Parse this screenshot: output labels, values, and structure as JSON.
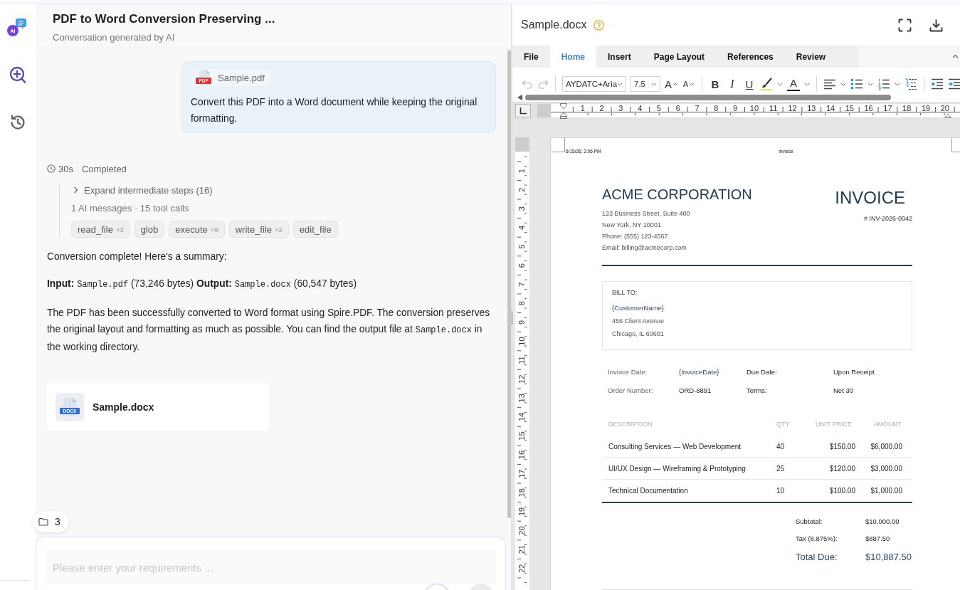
{
  "rail": {
    "logo_text": "AI"
  },
  "conversation": {
    "title": "PDF to Word Conversion Preserving ...",
    "subtitle": "Conversation generated by AI",
    "user_message": {
      "attachment": {
        "name": "Sample.pdf",
        "type_label": "PDF"
      },
      "text": "Convert this PDF into a Word document while keeping the original formatting."
    },
    "run": {
      "duration": "30s",
      "status": "Completed",
      "steps": {
        "label": "Expand intermediate steps (16)",
        "expanded": false,
        "summary": "1 AI messages · 15 tool calls",
        "tools": [
          {
            "name": "read_file",
            "count": "×3"
          },
          {
            "name": "glob"
          },
          {
            "name": "execute",
            "count": "×8"
          },
          {
            "name": "write_file",
            "count": "×2"
          },
          {
            "name": "edit_file"
          }
        ]
      }
    },
    "reply": [
      {
        "segments": [
          {
            "kind": "plain",
            "text": "Conversion complete! Here's a summary:"
          }
        ]
      },
      {
        "segments": [
          {
            "kind": "bold",
            "text": "Input:"
          },
          {
            "kind": "code",
            "text": "Sample.pdf"
          },
          {
            "kind": "plain",
            "text": "(73,246 bytes)"
          },
          {
            "kind": "bold",
            "text": "Output:"
          },
          {
            "kind": "code",
            "text": "Sample.docx"
          },
          {
            "kind": "plain",
            "text": "(60,547 bytes)"
          }
        ]
      },
      {
        "segments": [
          {
            "kind": "plain",
            "text": "The PDF has been successfully converted to Word format using Spire.PDF. The conversion preserves the original layout and formatting as much as possible. You can find the output file at"
          },
          {
            "kind": "code",
            "text": "Sample.docx"
          },
          {
            "kind": "plain",
            "text": "in the working directory."
          }
        ]
      }
    ],
    "result_file": {
      "name": "Sample.docx",
      "type_label": "DOCX"
    },
    "folder_badge": {
      "count": "3"
    },
    "composer": {
      "placeholder": "Please enter your requirements ..."
    }
  },
  "document": {
    "file_name": "Sample.docx",
    "ribbon_tabs": [
      {
        "label": "File",
        "selected": false
      },
      {
        "label": "Home",
        "selected": true
      },
      {
        "label": "Insert",
        "selected": false
      },
      {
        "label": "Page Layout",
        "selected": false
      },
      {
        "label": "References",
        "selected": false
      },
      {
        "label": "Review",
        "selected": false
      }
    ],
    "toolbar": {
      "undo": {
        "disabled": true
      },
      "redo": {
        "disabled": true
      },
      "font_name": "AYDATC+Aria",
      "font_size": "7.5",
      "grow_font": "A",
      "shrink_font": "A",
      "bold": "B",
      "italic": "I",
      "underline": "U",
      "font_color": "A"
    },
    "horizontal_ruler": [
      "1",
      "2",
      "3",
      "4",
      "5",
      "6",
      "7",
      "8",
      "9",
      "10",
      "11",
      "12",
      "13",
      "14",
      "15",
      "16",
      "17",
      "18",
      "19",
      "20"
    ],
    "vertical_ruler": [
      "1",
      "2",
      "3",
      "4",
      "5",
      "6",
      "7",
      "8",
      "9",
      "10",
      "11",
      "12",
      "13",
      "14",
      "15",
      "16",
      "17",
      "18",
      "19",
      "20",
      "21",
      "22"
    ],
    "page": {
      "header_left": "6/15/26, 2:06 PM",
      "header_center": "Invoice",
      "company": "ACME CORPORATION",
      "address_lines": [
        "123 Business Street, Suite 400",
        "New York, NY 10001",
        "Phone: (555) 123-4567",
        "Email: billing@acmecorp.com"
      ],
      "doc_title": "INVOICE",
      "invoice_number": "# INV-2026-0042",
      "bill_to": {
        "label": "BILL TO:",
        "name": "{CustomerName}",
        "lines": [
          "456 Client Avenue",
          "Chicago, IL 60601"
        ]
      },
      "details": [
        [
          {
            "kind": "label",
            "text": "Invoice Date:"
          },
          {
            "kind": "merge_field",
            "text": "{InvoiceDate}"
          },
          {
            "kind": "label",
            "text": "Due Date:"
          },
          {
            "kind": "value",
            "text": "Upon Receipt"
          }
        ],
        [
          {
            "kind": "label",
            "text": "Order Number:"
          },
          {
            "kind": "value",
            "text": "ORD-8891"
          },
          {
            "kind": "label",
            "text": "Terms:"
          },
          {
            "kind": "value",
            "text": "Net 30"
          }
        ]
      ],
      "items_table": {
        "columns": [
          "DESCRIPTION",
          "QTY",
          "UNIT PRICE",
          "AMOUNT"
        ],
        "rows": [
          [
            "Consulting Services — Web Development",
            "40",
            "$150.00",
            "$6,000.00"
          ],
          [
            "UI/UX Design — Wireframing & Prototyping",
            "25",
            "$120.00",
            "$3,000.00"
          ],
          [
            "Technical Documentation",
            "10",
            "$100.00",
            "$1,000.00"
          ]
        ]
      },
      "totals": [
        {
          "kind": "line",
          "label": "Subtotal:",
          "value": "$10,000.00"
        },
        {
          "kind": "line",
          "label": "Tax (8.875%):",
          "value": "$887.50"
        },
        {
          "kind": "total",
          "label": "Total Due:",
          "value": "$10,887.50"
        }
      ]
    }
  }
}
